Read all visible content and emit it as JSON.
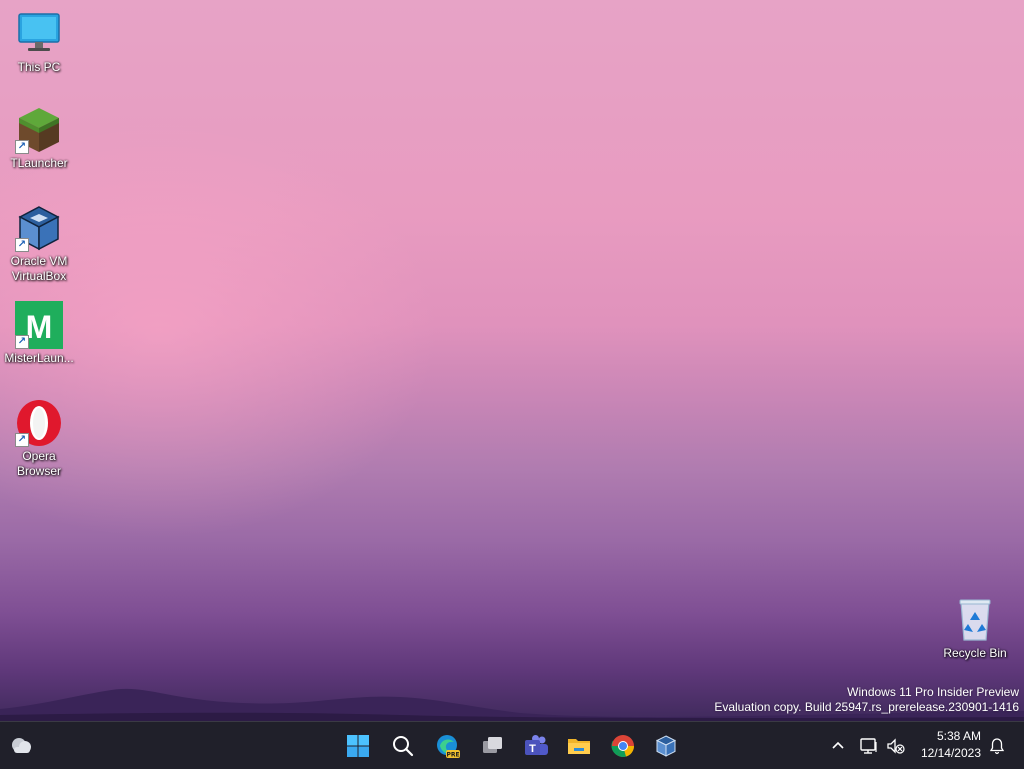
{
  "desktop": {
    "icons": [
      {
        "label": "This PC",
        "icon": "computer-monitor-icon"
      },
      {
        "label": "TLauncher",
        "icon": "grass-block-icon"
      },
      {
        "label": "Oracle VM VirtualBox",
        "icon": "virtualbox-cube-icon"
      },
      {
        "label": "MisterLaun...",
        "icon": "green-m-icon"
      },
      {
        "label": "Opera Browser",
        "icon": "opera-o-icon"
      },
      {
        "label": "Recycle Bin",
        "icon": "recycle-bin-icon"
      }
    ],
    "watermark": {
      "line1": "Windows 11 Pro Insider Preview",
      "line2": "Evaluation copy. Build 25947.rs_prerelease.230901-1416"
    }
  },
  "taskbar": {
    "pinned": [
      {
        "name": "start",
        "icon": "windows-logo-icon"
      },
      {
        "name": "search",
        "icon": "search-icon"
      },
      {
        "name": "edge",
        "icon": "edge-pre-icon"
      },
      {
        "name": "task-view",
        "icon": "task-view-icon"
      },
      {
        "name": "teams",
        "icon": "teams-icon"
      },
      {
        "name": "file-explorer",
        "icon": "folder-icon"
      },
      {
        "name": "chrome",
        "icon": "chrome-icon"
      },
      {
        "name": "virtualbox",
        "icon": "virtualbox-cube-icon"
      }
    ],
    "tray": {
      "time": "5:38 AM",
      "date": "12/14/2023"
    }
  }
}
